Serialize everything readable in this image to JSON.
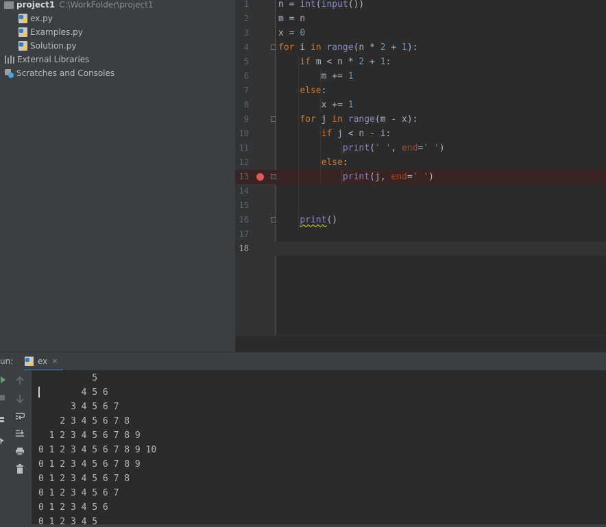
{
  "project_tree": {
    "root": {
      "name": "project1",
      "path": "C:\\WorkFolder\\project1",
      "icon": "folder-icon"
    },
    "files": [
      "ex.py",
      "Examples.py",
      "Solution.py"
    ],
    "external_libraries": "External Libraries",
    "scratches": "Scratches and Consoles"
  },
  "editor": {
    "lines": [
      {
        "n": "1",
        "code": "n = int(input())"
      },
      {
        "n": "2",
        "code": "m = n"
      },
      {
        "n": "3",
        "code": "x = 0"
      },
      {
        "n": "4",
        "code": "for i in range(n * 2 + 1):"
      },
      {
        "n": "5",
        "code": "    if m < n * 2 + 1:"
      },
      {
        "n": "6",
        "code": "        m += 1"
      },
      {
        "n": "7",
        "code": "    else:"
      },
      {
        "n": "8",
        "code": "        x += 1"
      },
      {
        "n": "9",
        "code": "    for j in range(m - x):"
      },
      {
        "n": "10",
        "code": "        if j < n - i:"
      },
      {
        "n": "11",
        "code": "            print(' ', end=' ')"
      },
      {
        "n": "12",
        "code": "        else:"
      },
      {
        "n": "13",
        "code": "            print(j, end=' ')"
      },
      {
        "n": "14",
        "code": ""
      },
      {
        "n": "15",
        "code": ""
      },
      {
        "n": "16",
        "code": "    print()"
      },
      {
        "n": "17",
        "code": ""
      },
      {
        "n": "18",
        "code": ""
      }
    ],
    "breakpoint_line": "13",
    "current_line": "18"
  },
  "run_panel": {
    "label": "un:",
    "tab": {
      "name": "ex",
      "close": "×"
    },
    "output": [
      "          5",
      "        4 5 6",
      "      3 4 5 6 7",
      "    2 3 4 5 6 7 8",
      "  1 2 3 4 5 6 7 8 9",
      "0 1 2 3 4 5 6 7 8 9 10",
      "0 1 2 3 4 5 6 7 8 9",
      "0 1 2 3 4 5 6 7 8",
      "0 1 2 3 4 5 6 7",
      "0 1 2 3 4 5 6",
      "0 1 2 3 4 5"
    ]
  },
  "colors": {
    "keyword": "#cc7832",
    "builtin": "#8888c6",
    "number": "#6897bb",
    "string": "#6a8759",
    "kwarg": "#aa4926",
    "breakpoint": "#db5c5c",
    "tab_underline": "#4a88c7"
  }
}
